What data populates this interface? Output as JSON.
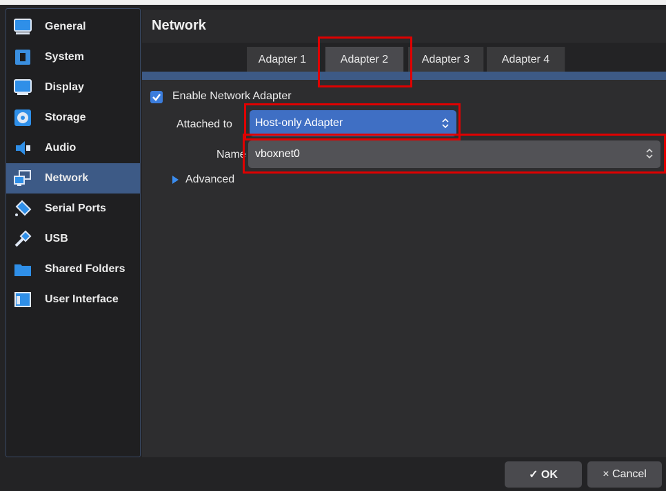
{
  "sidebar": {
    "items": [
      {
        "label": "General",
        "icon": "monitor-icon"
      },
      {
        "label": "System",
        "icon": "chip-icon"
      },
      {
        "label": "Display",
        "icon": "display-icon"
      },
      {
        "label": "Storage",
        "icon": "disk-icon"
      },
      {
        "label": "Audio",
        "icon": "speaker-icon"
      },
      {
        "label": "Network",
        "icon": "network-icon",
        "selected": true
      },
      {
        "label": "Serial Ports",
        "icon": "serial-port-icon"
      },
      {
        "label": "USB",
        "icon": "usb-icon"
      },
      {
        "label": "Shared Folders",
        "icon": "folder-icon"
      },
      {
        "label": "User Interface",
        "icon": "window-icon"
      }
    ]
  },
  "header": {
    "title": "Network"
  },
  "tabs": [
    {
      "label": "Adapter 1"
    },
    {
      "label": "Adapter 2",
      "selected": true
    },
    {
      "label": "Adapter 3"
    },
    {
      "label": "Adapter 4"
    }
  ],
  "adapter": {
    "enable_label": "Enable Network Adapter",
    "enabled": true,
    "attached_label": "Attached to",
    "attached_value": "Host-only Adapter",
    "name_label": "Name",
    "name_value": "vboxnet0",
    "advanced_label": "Advanced"
  },
  "buttons": {
    "ok_label": "✓ OK",
    "cancel_label": "× Cancel"
  },
  "colors": {
    "accent": "#3d5a86",
    "select_blue": "#3f6fc4",
    "highlight": "#e00000"
  }
}
